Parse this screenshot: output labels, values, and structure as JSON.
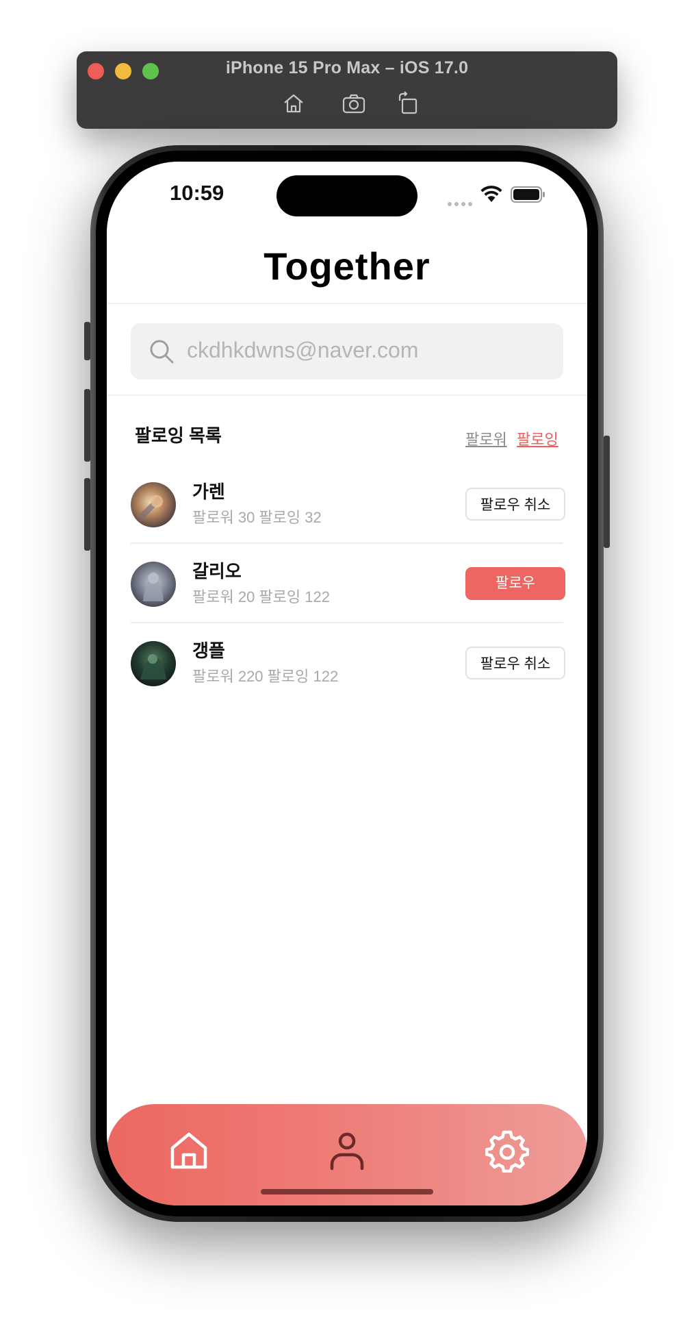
{
  "simulator": {
    "title": "iPhone 15 Pro Max – iOS 17.0",
    "tools": [
      "home-icon",
      "screenshot-icon",
      "rotate-icon"
    ]
  },
  "status_bar": {
    "time": "10:59"
  },
  "app": {
    "title": "Together"
  },
  "search": {
    "value": "ckdhkdwns@naver.com"
  },
  "list_section": {
    "title": "팔로잉 목록",
    "filter_follower": "팔로워",
    "filter_following": "팔로잉",
    "active_filter": "팔로잉"
  },
  "users": [
    {
      "name": "가렌",
      "stats": "팔로워 30 팔로잉 32",
      "button": "팔로우 취소",
      "following": true
    },
    {
      "name": "갈리오",
      "stats": "팔로워 20 팔로잉 122",
      "button": "팔로우",
      "following": false
    },
    {
      "name": "갱플",
      "stats": "팔로워 220 팔로잉 122",
      "button": "팔로우 취소",
      "following": true
    }
  ],
  "tab_bar": {
    "tabs": [
      "home-icon",
      "person-icon",
      "settings-gear-icon"
    ],
    "active_tab": "person-icon"
  },
  "colors": {
    "accent": "#ee6662",
    "tab_gradient_start": "#ec6861",
    "tab_gradient_end": "#ee9c98"
  }
}
